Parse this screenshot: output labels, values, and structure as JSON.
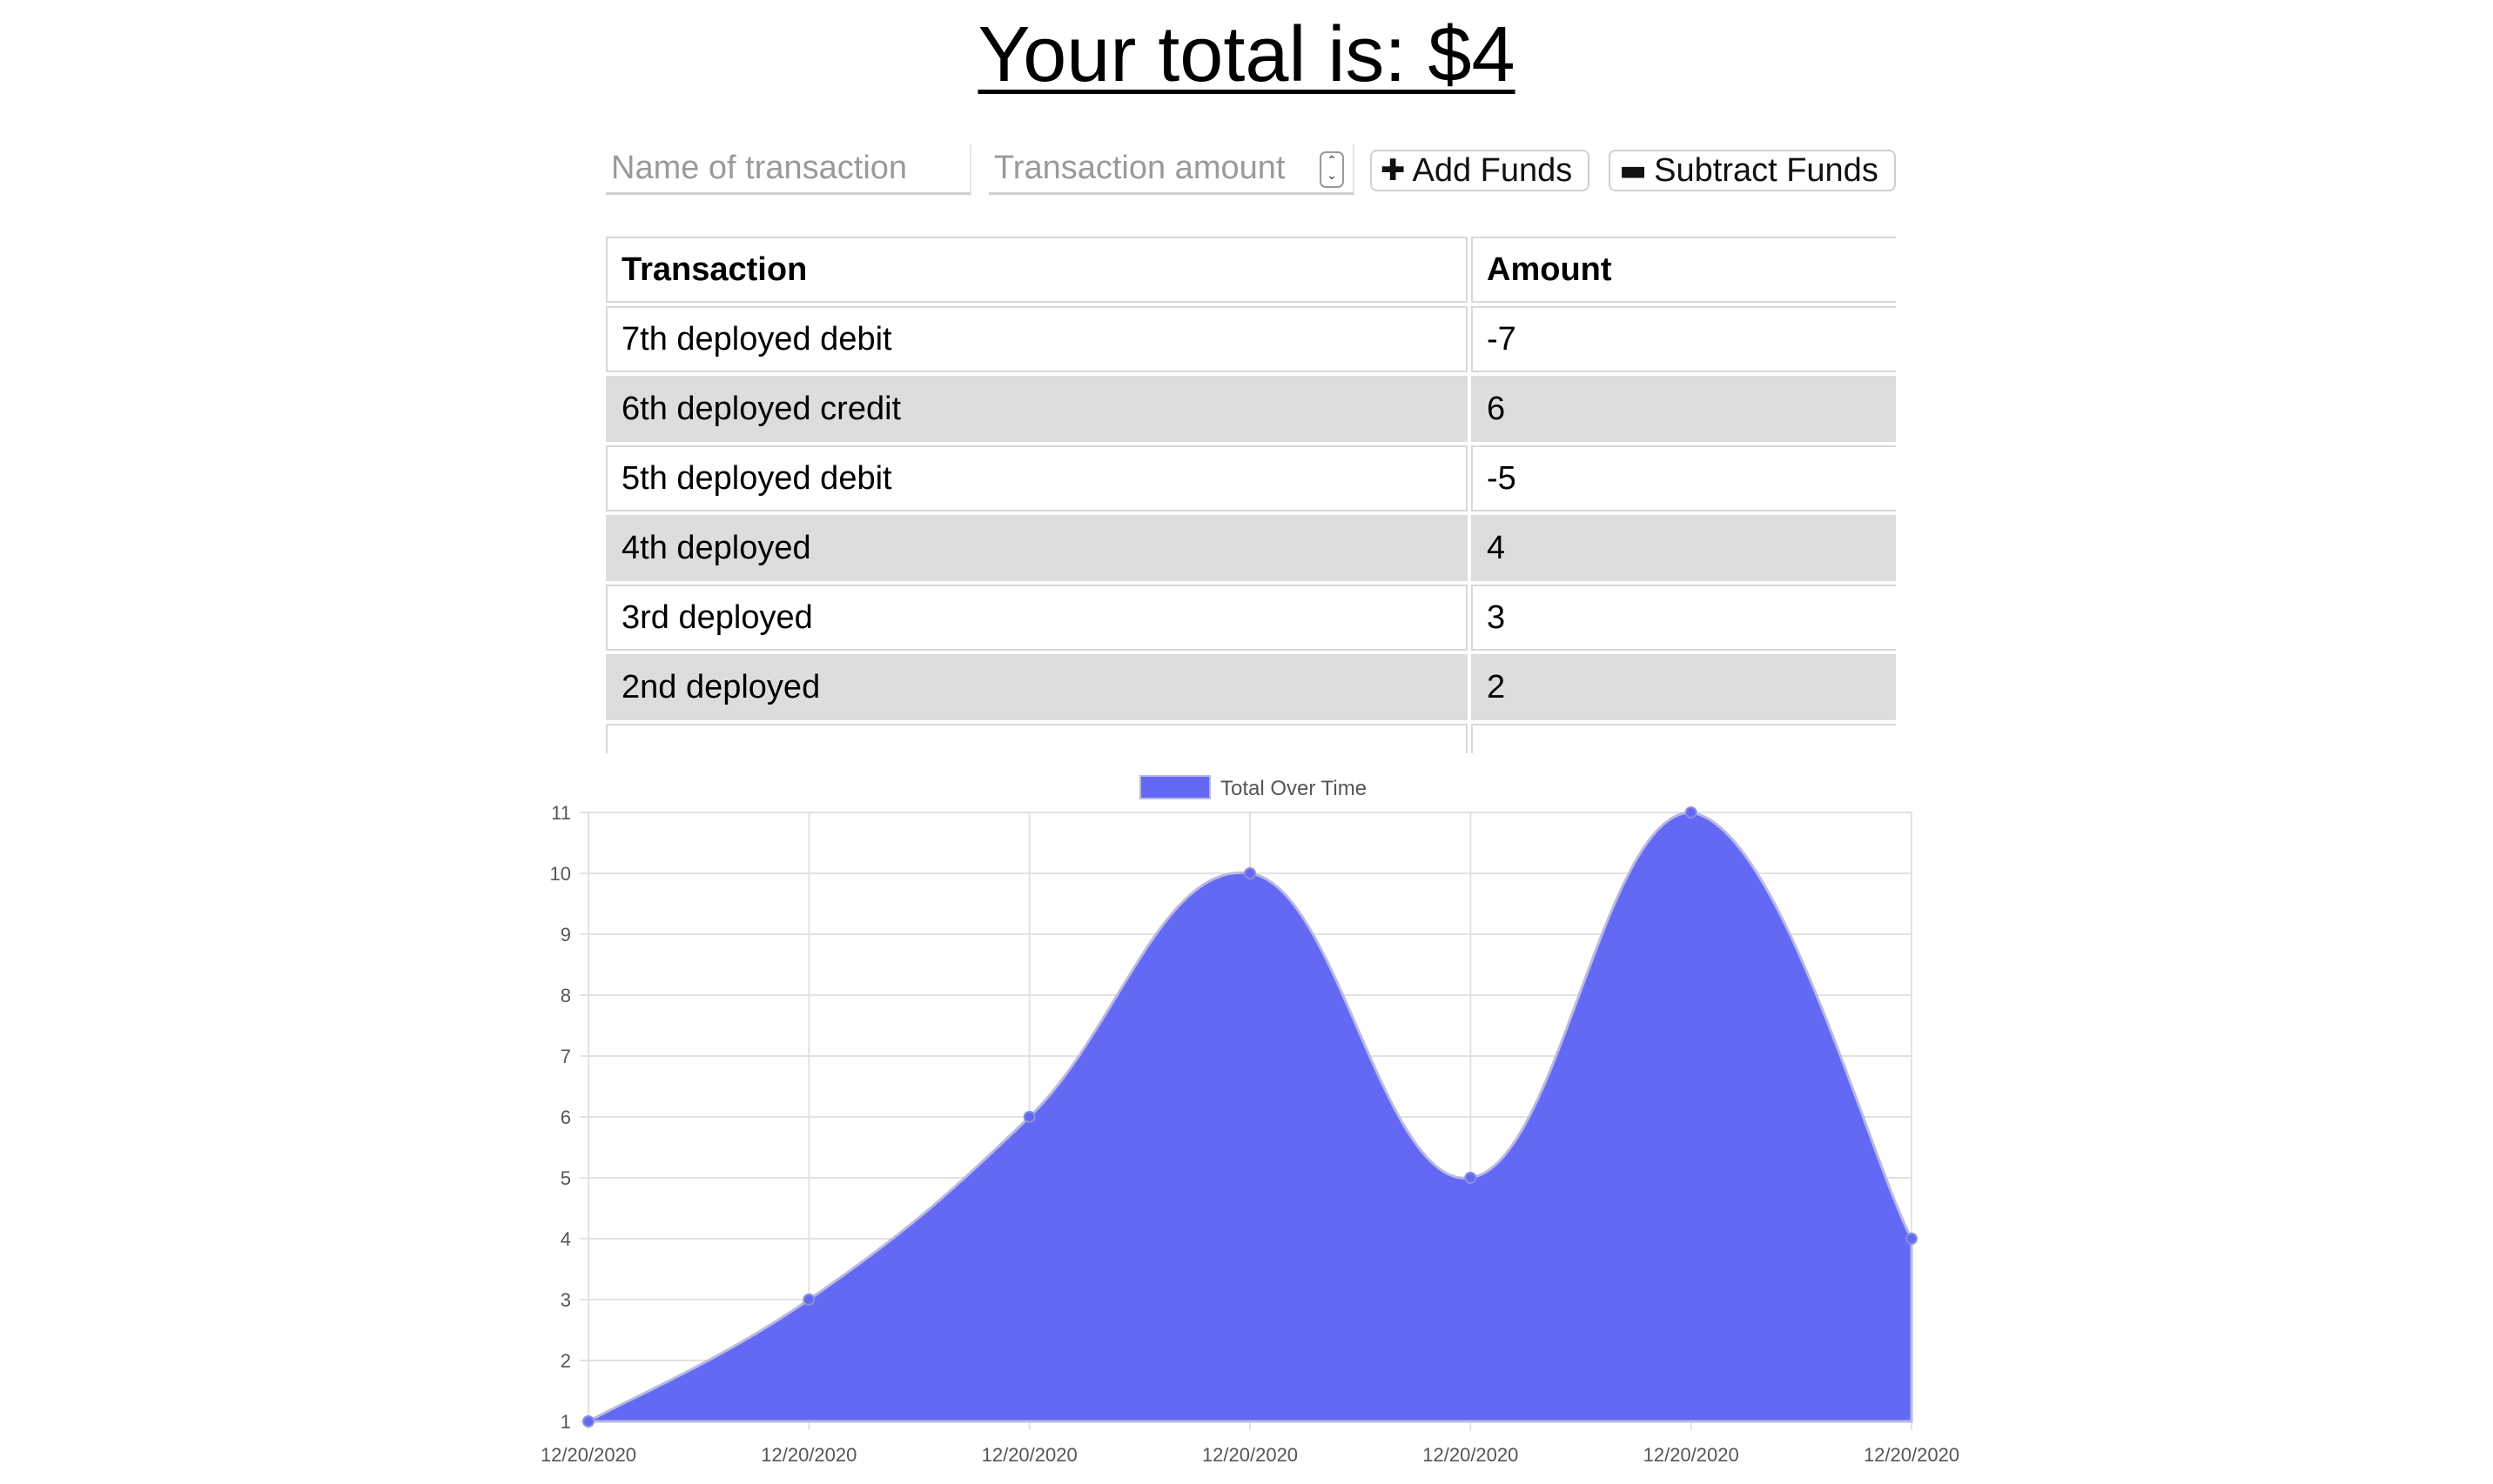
{
  "header": {
    "total_text": "Your total is: $4"
  },
  "form": {
    "name_placeholder": "Name of transaction",
    "amount_placeholder": "Transaction amount",
    "add_label": "Add Funds",
    "subtract_label": "Subtract Funds",
    "add_icon": "plus-icon",
    "subtract_icon": "minus-icon"
  },
  "table": {
    "headers": [
      "Transaction",
      "Amount"
    ],
    "rows": [
      {
        "name": "7th deployed debit",
        "amount": "-7"
      },
      {
        "name": "6th deployed credit",
        "amount": "6"
      },
      {
        "name": "5th deployed debit",
        "amount": "-5"
      },
      {
        "name": "4th deployed",
        "amount": "4"
      },
      {
        "name": "3rd deployed",
        "amount": "3"
      },
      {
        "name": "2nd deployed",
        "amount": "2"
      },
      {
        "name": "",
        "amount": ""
      }
    ],
    "stripe_color": "#dddddd"
  },
  "chart_data": {
    "type": "area",
    "title": "",
    "xlabel": "",
    "ylabel": "",
    "legend_position": "top",
    "grid": true,
    "color": "#6369f5",
    "categories": [
      "12/20/2020",
      "12/20/2020",
      "12/20/2020",
      "12/20/2020",
      "12/20/2020",
      "12/20/2020",
      "12/20/2020"
    ],
    "ylim": [
      1,
      11
    ],
    "yticks": [
      1,
      2,
      3,
      4,
      5,
      6,
      7,
      8,
      9,
      10,
      11
    ],
    "series": [
      {
        "name": "Total Over Time",
        "values": [
          1,
          3,
          6,
          10,
          5,
          11,
          4
        ]
      }
    ]
  }
}
